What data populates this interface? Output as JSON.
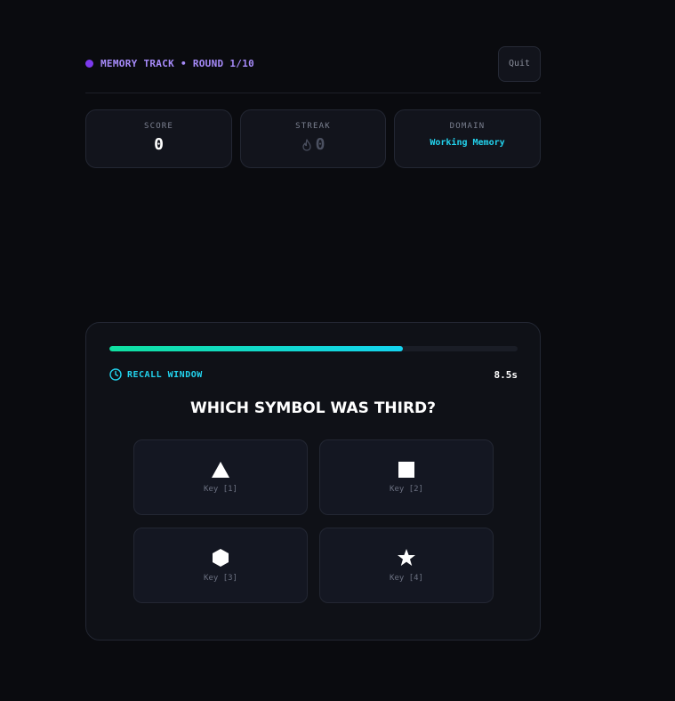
{
  "header": {
    "track_title": "MEMORY TRACK • ROUND 1/10",
    "quit_label": "Quit"
  },
  "stats": {
    "score": {
      "label": "SCORE",
      "value": "0"
    },
    "streak": {
      "label": "STREAK",
      "value": "0",
      "icon": "flame-icon"
    },
    "domain": {
      "label": "DOMAIN",
      "value": "Working Memory"
    }
  },
  "challenge": {
    "progress_fraction": 0.72,
    "recall_label": "RECALL WINDOW",
    "timer": "8.5s",
    "question": "WHICH SYMBOL WAS THIRD?",
    "options": [
      {
        "symbol": "triangle",
        "key": "Key [1]"
      },
      {
        "symbol": "square",
        "key": "Key [2]"
      },
      {
        "symbol": "hexagon",
        "key": "Key [3]"
      },
      {
        "symbol": "star",
        "key": "Key [4]"
      }
    ]
  },
  "colors": {
    "accent_purple": "#a78bfa",
    "accent_cyan": "#22d3ee",
    "progress_start": "#10e0a0",
    "progress_end": "#14d4f0"
  }
}
